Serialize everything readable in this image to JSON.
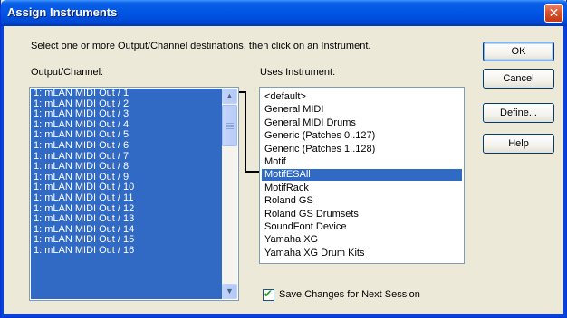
{
  "window": {
    "title": "Assign Instruments",
    "close_glyph": "✕"
  },
  "instructions": "Select one or more Output/Channel destinations, then click on an Instrument.",
  "output_label": "Output/Channel:",
  "uses_label": "Uses Instrument:",
  "outputs": [
    "1: mLAN MIDI Out / 1",
    "1: mLAN MIDI Out / 2",
    "1: mLAN MIDI Out / 3",
    "1: mLAN MIDI Out / 4",
    "1: mLAN MIDI Out / 5",
    "1: mLAN MIDI Out / 6",
    "1: mLAN MIDI Out / 7",
    "1: mLAN MIDI Out / 8",
    "1: mLAN MIDI Out / 9",
    "1: mLAN MIDI Out / 10",
    "1: mLAN MIDI Out / 11",
    "1: mLAN MIDI Out / 12",
    "1: mLAN MIDI Out / 13",
    "1: mLAN MIDI Out / 14",
    "1: mLAN MIDI Out / 15",
    "1: mLAN MIDI Out / 16"
  ],
  "instruments": [
    "<default>",
    "General MIDI",
    "General MIDI Drums",
    "Generic (Patches 0..127)",
    "Generic (Patches 1..128)",
    "Motif",
    "MotifESAll",
    "MotifRack",
    "Roland GS",
    "Roland GS Drumsets",
    "SoundFont Device",
    "Yamaha XG",
    "Yamaha XG Drum Kits"
  ],
  "selected_instrument": "MotifESAll",
  "buttons": {
    "ok": "OK",
    "cancel": "Cancel",
    "define": "Define...",
    "help": "Help"
  },
  "save_changes": {
    "label": "Save Changes for Next Session",
    "checked": true
  },
  "colors": {
    "selection": "#316ac5",
    "titlebar": "#0055e5",
    "dialog_bg": "#ece9d8"
  }
}
